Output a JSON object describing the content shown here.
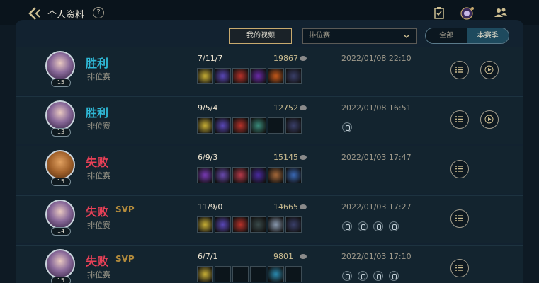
{
  "header": {
    "title": "个人资料",
    "help": "?"
  },
  "toolbar": {
    "my_videos": "我的视频",
    "queue_select": "排位赛",
    "seg_all": "全部",
    "seg_season": "本赛季"
  },
  "matches": [
    {
      "result": "胜利",
      "outcome": "win",
      "svp": "",
      "mode": "排位赛",
      "level": "15",
      "kda": "7/11/7",
      "gold": "19867",
      "date": "2022/01/08 22:10",
      "badges": 0,
      "has_replay": true,
      "items": [
        "#c9b035",
        "#5a47b8",
        "#b8322a",
        "#6a2aa8",
        "#c85a1a",
        "#3a3f6a"
      ]
    },
    {
      "result": "胜利",
      "outcome": "win",
      "svp": "",
      "mode": "排位赛",
      "level": "13",
      "kda": "9/5/4",
      "gold": "12752",
      "date": "2022/01/08 16:51",
      "badges": 1,
      "has_replay": true,
      "items": [
        "#c9b035",
        "#5a47b8",
        "#b8322a",
        "#3a8a7a",
        "",
        "#3a3f6a"
      ]
    },
    {
      "result": "失败",
      "outcome": "lose",
      "svp": "",
      "mode": "排位赛",
      "level": "15",
      "kda": "6/9/3",
      "gold": "15145",
      "date": "2022/01/03 17:47",
      "badges": 0,
      "has_replay": false,
      "items": [
        "#7a3ab8",
        "#6a4ab0",
        "#b83a4a",
        "#4a2aa0",
        "#a86a3a",
        "#3a6ab8"
      ]
    },
    {
      "result": "失败",
      "outcome": "lose",
      "svp": "SVP",
      "mode": "排位赛",
      "level": "14",
      "kda": "11/9/0",
      "gold": "14665",
      "date": "2022/01/03 17:27",
      "badges": 4,
      "has_replay": false,
      "items": [
        "#c9b035",
        "#5a47b8",
        "#b8322a",
        "#3a4a4a",
        "#8a9ab0",
        "#3a3f6a"
      ]
    },
    {
      "result": "失败",
      "outcome": "lose",
      "svp": "SVP",
      "mode": "排位赛",
      "level": "15",
      "kda": "6/7/1",
      "gold": "9801",
      "date": "2022/01/03 17:10",
      "badges": 4,
      "has_replay": false,
      "items": [
        "#c9b035",
        "",
        "",
        "",
        "#2a8ab0",
        ""
      ]
    }
  ],
  "colors": {
    "win": "#2fb8d6",
    "lose": "#e84057",
    "gold": "#c8aa6e",
    "bg": "#0e1a24"
  }
}
